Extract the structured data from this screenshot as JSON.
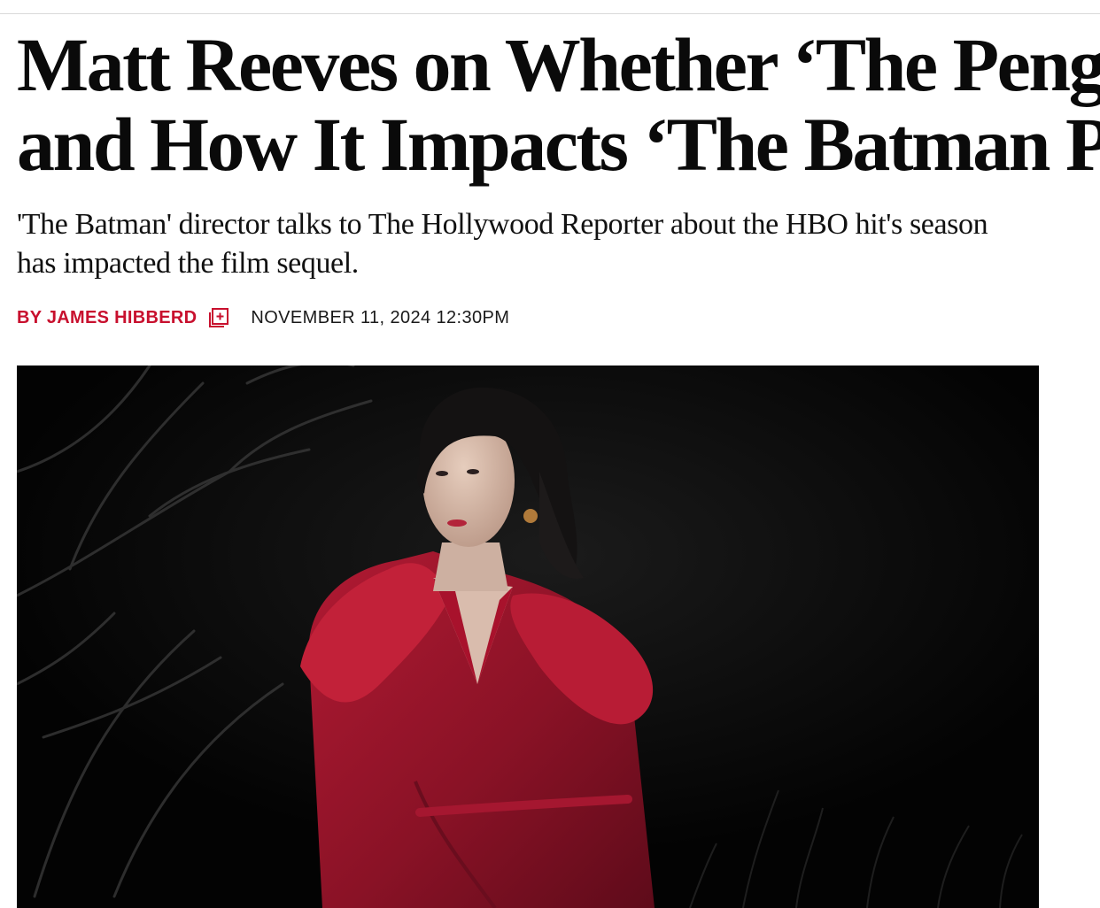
{
  "article": {
    "headline_line1": "Matt Reeves on Whether ‘The Penguin’",
    "headline_line2": "and How It Impacts ‘The Batman Part II’",
    "dek_line1": "'The Batman' director talks to The Hollywood Reporter about the HBO hit's season",
    "dek_line2": "has impacted the film sequel.",
    "byline": "BY JAMES HIBBERD",
    "timestamp": "NOVEMBER 11, 2024 12:30PM"
  },
  "icons": {
    "follow_author": "follow-author-icon"
  },
  "colors": {
    "accent": "#c8102e",
    "headline": "#0a0a0a",
    "hero_background": "#050505",
    "coat": "#9b1428"
  }
}
